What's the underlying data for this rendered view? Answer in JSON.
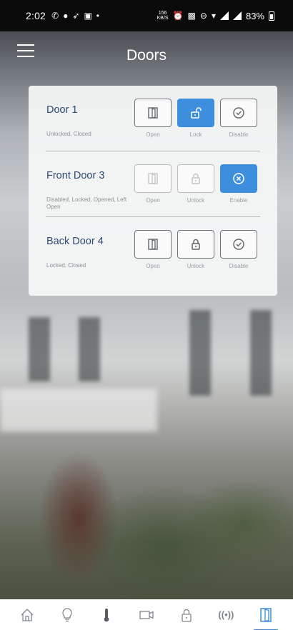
{
  "status_bar": {
    "time": "2:02",
    "speed_value": "156",
    "speed_unit": "KB/S",
    "battery": "83%"
  },
  "header": {
    "title": "Doors",
    "menu_icon": "hamburger-menu-icon"
  },
  "doors": [
    {
      "name": "Door 1",
      "status": "Unlocked, Closed",
      "buttons": [
        {
          "label": "Open",
          "icon": "door-icon",
          "state": "normal"
        },
        {
          "label": "Lock",
          "icon": "unlocked-padlock-icon",
          "state": "active"
        },
        {
          "label": "Disable",
          "icon": "check-circle-icon",
          "state": "normal"
        }
      ]
    },
    {
      "name": "Front Door 3",
      "status": "Disabled, Locked, Opened, Left Open",
      "buttons": [
        {
          "label": "Open",
          "icon": "door-icon",
          "state": "disabled"
        },
        {
          "label": "Unlock",
          "icon": "locked-padlock-icon",
          "state": "disabled"
        },
        {
          "label": "Enable",
          "icon": "x-circle-icon",
          "state": "active"
        }
      ]
    },
    {
      "name": "Back Door 4",
      "status": "Locked, Closed",
      "buttons": [
        {
          "label": "Open",
          "icon": "door-icon",
          "state": "normal"
        },
        {
          "label": "Unlock",
          "icon": "locked-padlock-icon",
          "state": "normal"
        },
        {
          "label": "Disable",
          "icon": "check-circle-icon",
          "state": "normal"
        }
      ]
    }
  ],
  "bottom_nav": [
    {
      "icon": "home-icon",
      "active": false
    },
    {
      "icon": "lightbulb-icon",
      "active": false
    },
    {
      "icon": "thermometer-icon",
      "active": false
    },
    {
      "icon": "camera-icon",
      "active": false
    },
    {
      "icon": "padlock-icon",
      "active": false
    },
    {
      "icon": "broadcast-icon",
      "active": false,
      "text": "((•))"
    },
    {
      "icon": "door-icon",
      "active": true
    }
  ],
  "colors": {
    "accent": "#3e8ede",
    "door_name": "#2c4a73",
    "status_text": "#8c9298"
  }
}
